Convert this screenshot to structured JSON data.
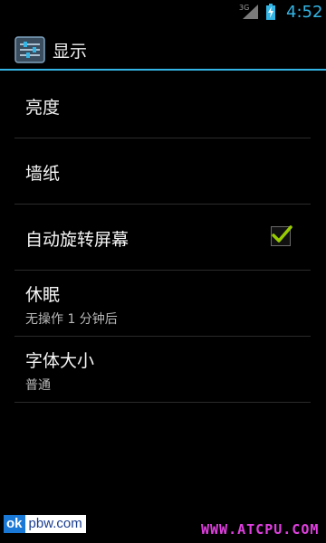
{
  "status_bar": {
    "network_type": "3G",
    "time": "4:52"
  },
  "action_bar": {
    "title": "显示",
    "icon": "settings-sliders-icon"
  },
  "settings": {
    "items": [
      {
        "title": "亮度"
      },
      {
        "title": "墙纸"
      },
      {
        "title": "自动旋转屏幕",
        "checked": true
      },
      {
        "title": "休眠",
        "summary": "无操作 1 分钟后"
      },
      {
        "title": "字体大小",
        "summary": "普通"
      }
    ]
  },
  "watermarks": {
    "left_badge": "ok",
    "left_text": "pbw.com",
    "right_text": "WWW.ATCPU.COM"
  },
  "colors": {
    "accent": "#33b5e5",
    "checkmark": "#99cc00",
    "watermark_right": "#e040e0"
  }
}
